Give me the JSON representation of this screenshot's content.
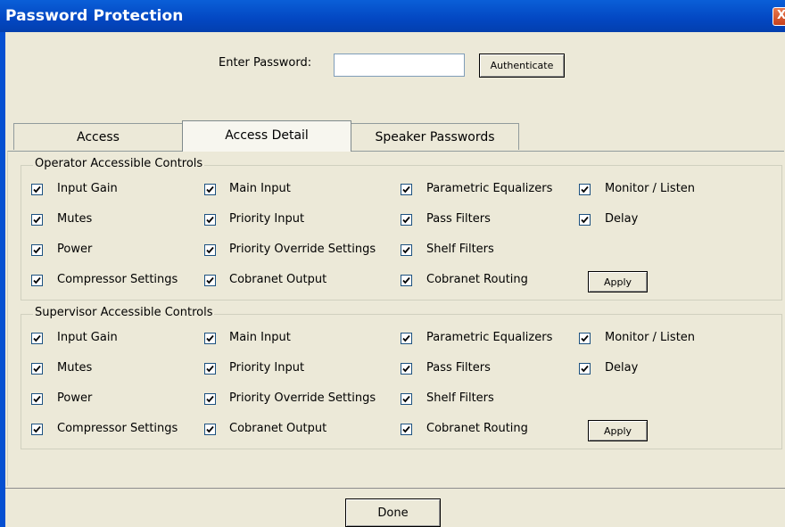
{
  "window": {
    "title": "Password Protection",
    "close_glyph": "X"
  },
  "auth": {
    "label": "Enter Password:",
    "value": "",
    "button_label": "Authenticate"
  },
  "tabs": [
    {
      "label": "Access",
      "active": false
    },
    {
      "label": "Access Detail",
      "active": true
    },
    {
      "label": "Speaker Passwords",
      "active": false
    }
  ],
  "groups": [
    {
      "title": "Operator Accessible Controls",
      "apply_label": "Apply",
      "checkboxes": [
        {
          "label": "Input Gain",
          "checked": true
        },
        {
          "label": "Main Input",
          "checked": true
        },
        {
          "label": "Parametric Equalizers",
          "checked": true
        },
        {
          "label": "Monitor / Listen",
          "checked": true
        },
        {
          "label": "Mutes",
          "checked": true
        },
        {
          "label": "Priority Input",
          "checked": true
        },
        {
          "label": "Pass Filters",
          "checked": true
        },
        {
          "label": "Delay",
          "checked": true
        },
        {
          "label": "Power",
          "checked": true
        },
        {
          "label": "Priority Override Settings",
          "checked": true
        },
        {
          "label": "Shelf Filters",
          "checked": true
        },
        {
          "label": "Compressor Settings",
          "checked": true
        },
        {
          "label": "Cobranet Output",
          "checked": true
        },
        {
          "label": "Cobranet Routing",
          "checked": true
        }
      ]
    },
    {
      "title": "Supervisor Accessible Controls",
      "apply_label": "Apply",
      "checkboxes": [
        {
          "label": "Input Gain",
          "checked": true
        },
        {
          "label": "Main Input",
          "checked": true
        },
        {
          "label": "Parametric Equalizers",
          "checked": true
        },
        {
          "label": "Monitor / Listen",
          "checked": true
        },
        {
          "label": "Mutes",
          "checked": true
        },
        {
          "label": "Priority Input",
          "checked": true
        },
        {
          "label": "Pass Filters",
          "checked": true
        },
        {
          "label": "Delay",
          "checked": true
        },
        {
          "label": "Power",
          "checked": true
        },
        {
          "label": "Priority Override Settings",
          "checked": true
        },
        {
          "label": "Shelf Filters",
          "checked": true
        },
        {
          "label": "Compressor Settings",
          "checked": true
        },
        {
          "label": "Cobranet Output",
          "checked": true
        },
        {
          "label": "Cobranet Routing",
          "checked": true
        }
      ]
    }
  ],
  "footer": {
    "done_label": "Done"
  },
  "colors": {
    "titlebar": "#0347c2",
    "dialog_bg": "#ece9d8",
    "checkbox_border": "#1c5180"
  }
}
